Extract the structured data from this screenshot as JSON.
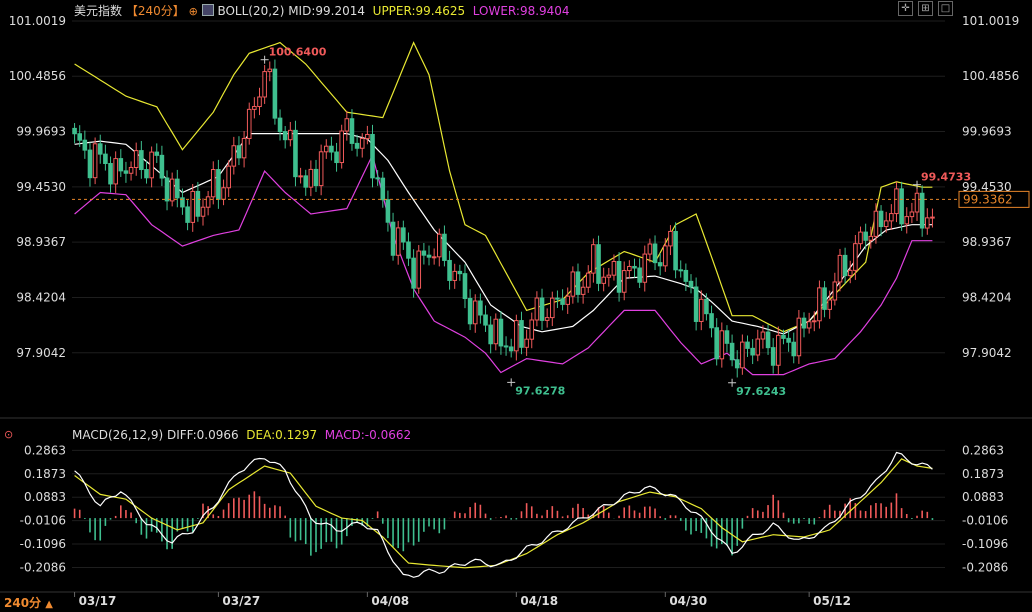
{
  "header": {
    "instrument": "美元指数",
    "period_badge": "【240分】",
    "boll_label": "BOLL(20,2)",
    "mid": "MID:99.2014",
    "upper": "UPPER:99.4625",
    "lower": "LOWER:98.9404"
  },
  "macd_header": {
    "label": "MACD(26,12,9)",
    "diff": "DIFF:0.0966",
    "dea": "DEA:0.1297",
    "macd": "MACD:-0.0662"
  },
  "footer": {
    "period": "240分",
    "arrow": "▲"
  },
  "colors": {
    "background": "#000000",
    "up": "#f05a5a",
    "down": "#3fbf8f",
    "mid_line": "#ffffff",
    "upper_line": "#e8e832",
    "lower_line": "#e040e0",
    "current_price_line": "#e8862a",
    "header_badge": "#f08a30",
    "upper_text": "#e8e832",
    "lower_text": "#e040e0"
  },
  "icons": [
    "boll-icon",
    "crosshair-icon",
    "zoom-icon",
    "maximize-icon",
    "close-icon",
    "settings-icon"
  ],
  "chart_data": [
    {
      "type": "candlestick",
      "title": "美元指数",
      "ylim": [
        97.65,
        101.02
      ],
      "yticks": [
        "101.0019",
        "100.4856",
        "99.9693",
        "99.4530",
        "98.9367",
        "98.4204",
        "97.9042"
      ],
      "ytick_values": [
        101.0019,
        100.4856,
        99.9693,
        99.453,
        98.9367,
        98.4204,
        97.9042
      ],
      "xticks": [
        "03/17",
        "03/27",
        "04/08",
        "04/18",
        "04/30",
        "05/12"
      ],
      "xtick_index": [
        0,
        28,
        57,
        86,
        115,
        143
      ],
      "current_price": 99.3362,
      "current_price_label": "99.3362",
      "annotations": [
        {
          "text": "100.6400",
          "value": 100.64,
          "index": 37,
          "kind": "high"
        },
        {
          "text": "97.6278",
          "value": 97.6278,
          "index": 85,
          "kind": "low"
        },
        {
          "text": "97.6243",
          "value": 97.6243,
          "index": 128,
          "kind": "low"
        },
        {
          "text": "99.4733",
          "value": 99.4733,
          "index": 164,
          "kind": "high"
        }
      ],
      "close_anchors": [
        [
          0,
          99.85
        ],
        [
          8,
          99.6
        ],
        [
          15,
          99.7
        ],
        [
          22,
          99.2
        ],
        [
          28,
          99.45
        ],
        [
          32,
          99.8
        ],
        [
          37,
          100.52
        ],
        [
          41,
          99.9
        ],
        [
          45,
          99.45
        ],
        [
          48,
          99.7
        ],
        [
          53,
          99.95
        ],
        [
          57,
          99.85
        ],
        [
          61,
          99.1
        ],
        [
          66,
          98.7
        ],
        [
          71,
          98.9
        ],
        [
          74,
          98.6
        ],
        [
          79,
          98.2
        ],
        [
          85,
          97.95
        ],
        [
          90,
          98.25
        ],
        [
          96,
          98.45
        ],
        [
          101,
          98.7
        ],
        [
          106,
          98.6
        ],
        [
          111,
          98.75
        ],
        [
          116,
          98.9
        ],
        [
          119,
          98.55
        ],
        [
          123,
          98.2
        ],
        [
          128,
          97.85
        ],
        [
          133,
          98.0
        ],
        [
          138,
          97.95
        ],
        [
          143,
          98.2
        ],
        [
          148,
          98.55
        ],
        [
          153,
          98.95
        ],
        [
          158,
          99.2
        ],
        [
          162,
          99.25
        ],
        [
          167,
          99.15
        ]
      ],
      "upper_anchors": [
        [
          0,
          100.6
        ],
        [
          10,
          100.3
        ],
        [
          16,
          100.2
        ],
        [
          21,
          99.8
        ],
        [
          27,
          100.15
        ],
        [
          31,
          100.5
        ],
        [
          34,
          100.7
        ],
        [
          40,
          100.8
        ],
        [
          45,
          100.6
        ],
        [
          53,
          100.15
        ],
        [
          60,
          100.1
        ],
        [
          66,
          100.8
        ],
        [
          69,
          100.5
        ],
        [
          73,
          99.6
        ],
        [
          76,
          99.1
        ],
        [
          80,
          99.0
        ],
        [
          84,
          98.65
        ],
        [
          88,
          98.3
        ],
        [
          95,
          98.4
        ],
        [
          100,
          98.65
        ],
        [
          107,
          98.85
        ],
        [
          113,
          98.75
        ],
        [
          117,
          99.1
        ],
        [
          121,
          99.2
        ],
        [
          124,
          98.8
        ],
        [
          128,
          98.25
        ],
        [
          132,
          98.25
        ],
        [
          138,
          98.1
        ],
        [
          143,
          98.2
        ],
        [
          148,
          98.45
        ],
        [
          154,
          98.75
        ],
        [
          157,
          99.45
        ],
        [
          160,
          99.5
        ],
        [
          165,
          99.45
        ],
        [
          167,
          99.45
        ]
      ],
      "mid_anchors": [
        [
          0,
          99.85
        ],
        [
          5,
          99.88
        ],
        [
          10,
          99.85
        ],
        [
          15,
          99.65
        ],
        [
          21,
          99.4
        ],
        [
          28,
          99.55
        ],
        [
          34,
          99.95
        ],
        [
          40,
          99.95
        ],
        [
          46,
          99.95
        ],
        [
          53,
          99.95
        ],
        [
          57,
          99.9
        ],
        [
          61,
          99.7
        ],
        [
          65,
          99.4
        ],
        [
          70,
          99.05
        ],
        [
          76,
          98.75
        ],
        [
          81,
          98.35
        ],
        [
          87,
          98.15
        ],
        [
          91,
          98.1
        ],
        [
          97,
          98.15
        ],
        [
          101,
          98.3
        ],
        [
          107,
          98.6
        ],
        [
          113,
          98.62
        ],
        [
          118,
          98.55
        ],
        [
          121,
          98.5
        ],
        [
          124,
          98.38
        ],
        [
          128,
          98.2
        ],
        [
          133,
          98.15
        ],
        [
          138,
          98.08
        ],
        [
          143,
          98.2
        ],
        [
          148,
          98.5
        ],
        [
          154,
          98.9
        ],
        [
          158,
          99.05
        ],
        [
          163,
          99.1
        ],
        [
          167,
          99.1
        ]
      ],
      "lower_anchors": [
        [
          0,
          99.2
        ],
        [
          5,
          99.4
        ],
        [
          10,
          99.38
        ],
        [
          15,
          99.1
        ],
        [
          21,
          98.9
        ],
        [
          27,
          99.0
        ],
        [
          32,
          99.05
        ],
        [
          37,
          99.6
        ],
        [
          41,
          99.4
        ],
        [
          46,
          99.2
        ],
        [
          53,
          99.25
        ],
        [
          58,
          99.75
        ],
        [
          62,
          99.0
        ],
        [
          66,
          98.5
        ],
        [
          70,
          98.2
        ],
        [
          76,
          98.05
        ],
        [
          80,
          97.9
        ],
        [
          83,
          97.72
        ],
        [
          88,
          97.85
        ],
        [
          95,
          97.8
        ],
        [
          100,
          97.95
        ],
        [
          107,
          98.3
        ],
        [
          113,
          98.3
        ],
        [
          118,
          98.0
        ],
        [
          122,
          97.8
        ],
        [
          127,
          97.9
        ],
        [
          132,
          97.7
        ],
        [
          138,
          97.7
        ],
        [
          143,
          97.8
        ],
        [
          148,
          97.85
        ],
        [
          153,
          98.1
        ],
        [
          157,
          98.35
        ],
        [
          160,
          98.6
        ],
        [
          163,
          98.95
        ],
        [
          167,
          98.95
        ]
      ]
    },
    {
      "type": "macd",
      "title": "MACD(26,12,9)",
      "ylim": [
        -0.27,
        0.33
      ],
      "yticks": [
        "0.2863",
        "0.1873",
        "0.0883",
        "-0.0106",
        "-0.1096",
        "-0.2086"
      ],
      "ytick_values": [
        0.2863,
        0.1873,
        0.0883,
        -0.0106,
        -0.1096,
        -0.2086
      ],
      "diff_anchors": [
        [
          0,
          0.2
        ],
        [
          5,
          0.05
        ],
        [
          9,
          0.12
        ],
        [
          14,
          -0.02
        ],
        [
          19,
          -0.1
        ],
        [
          23,
          -0.05
        ],
        [
          27,
          0.05
        ],
        [
          32,
          0.2
        ],
        [
          37,
          0.26
        ],
        [
          41,
          0.2
        ],
        [
          46,
          0.0
        ],
        [
          51,
          -0.05
        ],
        [
          56,
          -0.02
        ],
        [
          59,
          -0.06
        ],
        [
          64,
          -0.25
        ],
        [
          68,
          -0.23
        ],
        [
          72,
          -0.22
        ],
        [
          77,
          -0.18
        ],
        [
          83,
          -0.2
        ],
        [
          88,
          -0.13
        ],
        [
          93,
          -0.07
        ],
        [
          99,
          0.0
        ],
        [
          106,
          0.08
        ],
        [
          111,
          0.13
        ],
        [
          116,
          0.1
        ],
        [
          121,
          0.02
        ],
        [
          124,
          -0.05
        ],
        [
          128,
          -0.15
        ],
        [
          132,
          -0.08
        ],
        [
          136,
          -0.03
        ],
        [
          141,
          -0.1
        ],
        [
          146,
          -0.05
        ],
        [
          151,
          0.06
        ],
        [
          156,
          0.15
        ],
        [
          160,
          0.27
        ],
        [
          164,
          0.23
        ],
        [
          167,
          0.21
        ]
      ],
      "dea_anchors": [
        [
          0,
          0.18
        ],
        [
          5,
          0.1
        ],
        [
          10,
          0.08
        ],
        [
          15,
          0.0
        ],
        [
          20,
          -0.05
        ],
        [
          25,
          -0.02
        ],
        [
          30,
          0.12
        ],
        [
          37,
          0.22
        ],
        [
          42,
          0.19
        ],
        [
          47,
          0.05
        ],
        [
          52,
          0.0
        ],
        [
          56,
          -0.01
        ],
        [
          60,
          -0.08
        ],
        [
          65,
          -0.19
        ],
        [
          70,
          -0.2
        ],
        [
          76,
          -0.21
        ],
        [
          82,
          -0.2
        ],
        [
          88,
          -0.15
        ],
        [
          94,
          -0.07
        ],
        [
          99,
          -0.02
        ],
        [
          106,
          0.07
        ],
        [
          112,
          0.11
        ],
        [
          117,
          0.09
        ],
        [
          122,
          0.04
        ],
        [
          126,
          -0.04
        ],
        [
          130,
          -0.1
        ],
        [
          136,
          -0.07
        ],
        [
          142,
          -0.08
        ],
        [
          147,
          -0.05
        ],
        [
          152,
          0.05
        ],
        [
          157,
          0.15
        ],
        [
          161,
          0.25
        ],
        [
          164,
          0.22
        ],
        [
          167,
          0.21
        ]
      ]
    }
  ]
}
